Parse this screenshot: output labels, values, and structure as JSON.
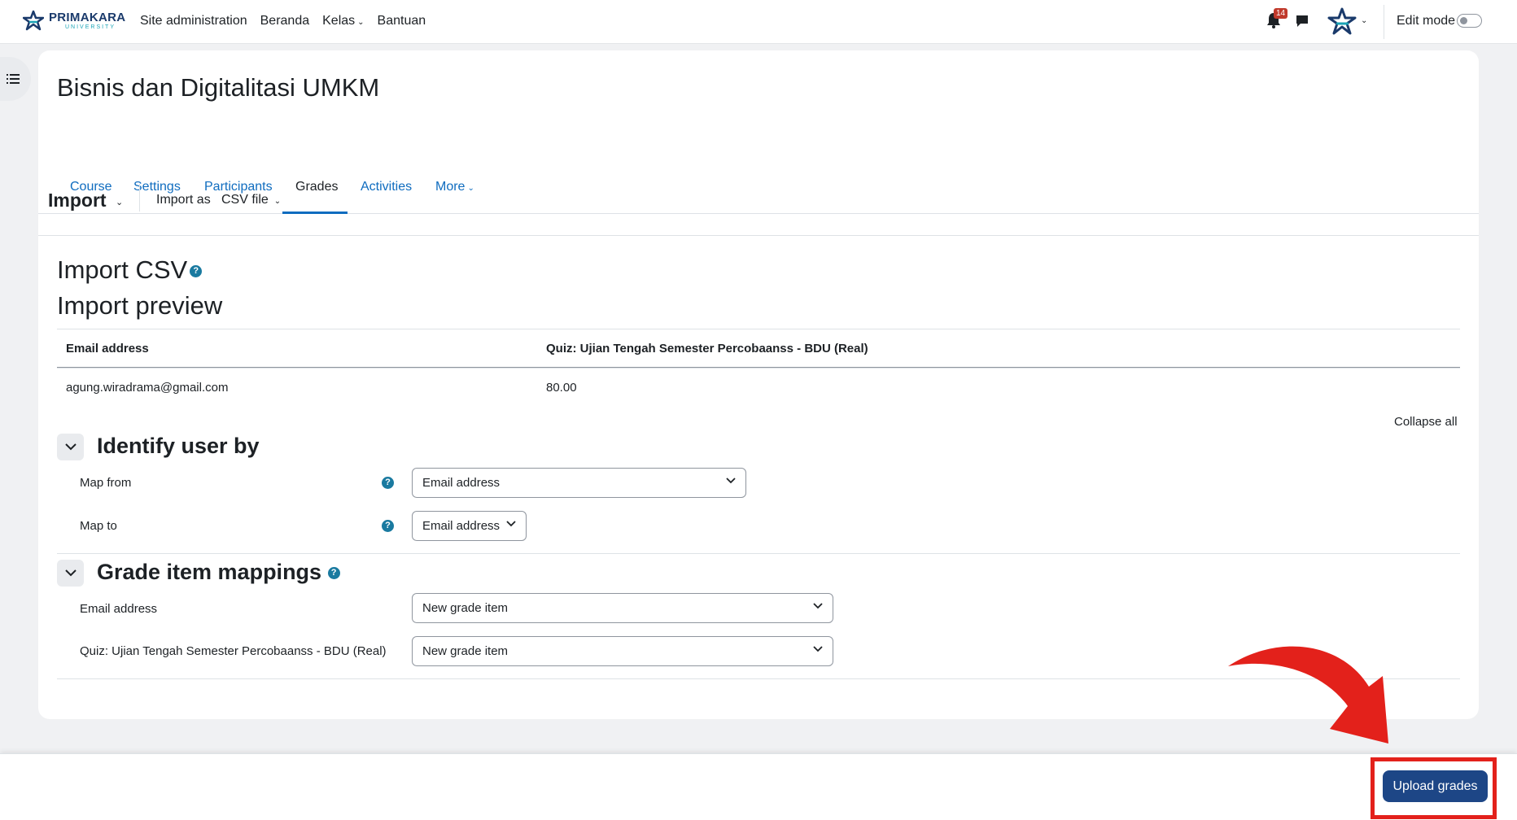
{
  "navbar": {
    "logo_text": "PRIMAKARA",
    "logo_sub": "UNIVERSITY",
    "items": [
      {
        "label": "Site administration"
      },
      {
        "label": "Beranda"
      },
      {
        "label": "Kelas"
      },
      {
        "label": "Bantuan"
      }
    ],
    "notification_count": "14",
    "edit_mode_label": "Edit mode",
    "edit_mode_on": false
  },
  "course": {
    "title": "Bisnis dan Digitalitasi UMKM",
    "tabs": [
      {
        "label": "Course"
      },
      {
        "label": "Settings"
      },
      {
        "label": "Participants"
      },
      {
        "label": "Grades"
      },
      {
        "label": "Activities"
      },
      {
        "label": "More"
      }
    ],
    "active_tab": "Grades"
  },
  "import_bar": {
    "title": "Import",
    "import_as_label": "Import as",
    "import_as_value": "CSV file"
  },
  "page": {
    "heading": "Import CSV",
    "subheading": "Import preview"
  },
  "preview_table": {
    "headers": [
      "Email address",
      "Quiz: Ujian Tengah Semester Percobaanss - BDU (Real)"
    ],
    "rows": [
      [
        "agung.wiradrama@gmail.com",
        "80.00"
      ]
    ]
  },
  "collapse_all": "Collapse all",
  "identify_user": {
    "title": "Identify user by",
    "map_from_label": "Map from",
    "map_from_value": "Email address",
    "map_to_label": "Map to",
    "map_to_value": "Email address"
  },
  "grade_mappings": {
    "title": "Grade item mappings",
    "items": [
      {
        "label": "Email address",
        "value": "New grade item"
      },
      {
        "label": "Quiz: Ujian Tengah Semester Percobaanss - BDU (Real)",
        "value": "New grade item"
      }
    ]
  },
  "footer": {
    "upload_label": "Upload grades"
  },
  "colors": {
    "link": "#0f6cbf",
    "primary_button": "#1d4686",
    "annotation_red": "#e3211b",
    "help_icon": "#1a7aa0"
  }
}
